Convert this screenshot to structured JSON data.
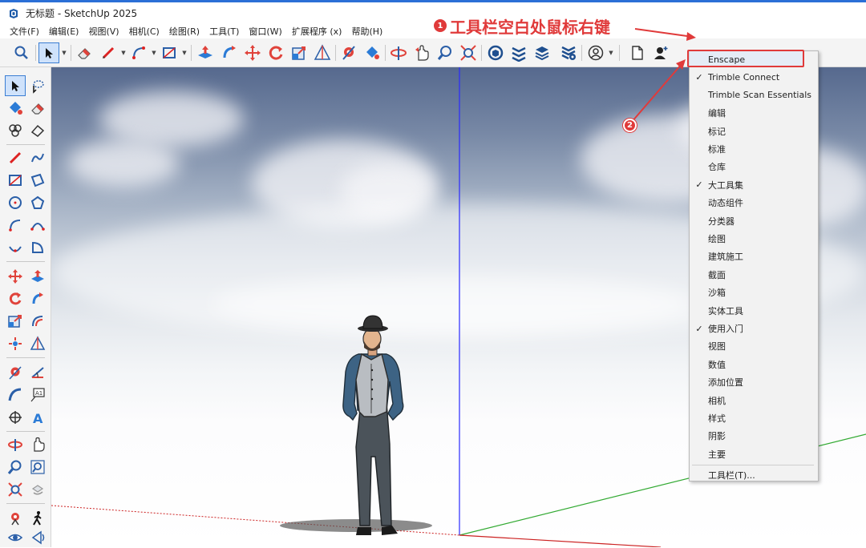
{
  "window": {
    "title": "无标题 - SketchUp 2025",
    "accent": "#2b6fd6"
  },
  "menubar": {
    "items": [
      "文件(F)",
      "编辑(E)",
      "视图(V)",
      "相机(C)",
      "绘图(R)",
      "工具(T)",
      "窗口(W)",
      "扩展程序 (x)",
      "帮助(H)"
    ]
  },
  "toolbar": {
    "icons": [
      "zoom-extents-icon",
      "select-icon",
      "eraser-icon",
      "pencil-line-icon",
      "arc-icon",
      "rectangle-icon",
      "push-pull-icon",
      "follow-me-icon",
      "move-icon",
      "rotate-icon",
      "scale-icon",
      "tape-icon",
      "position-camera-icon",
      "paint-bucket-icon",
      "orbit-icon",
      "pan-icon",
      "zoom-icon",
      "zoom-window-icon",
      "3d-warehouse-icon",
      "extension-warehouse-icon",
      "layout-icon",
      "extension-manager-icon",
      "account-icon",
      "new-file-icon",
      "add-user-icon"
    ]
  },
  "annotation": {
    "step1_badge": "1",
    "step1_text": "工具栏空白处鼠标右键",
    "step2_badge": "2",
    "color": "#e03a3a"
  },
  "context_menu": {
    "items": [
      {
        "label": "Enscape",
        "checked": false,
        "highlighted": true
      },
      {
        "label": "Trimble Connect",
        "checked": true
      },
      {
        "label": "Trimble Scan Essentials",
        "checked": false
      },
      {
        "label": "编辑",
        "checked": false
      },
      {
        "label": "标记",
        "checked": false
      },
      {
        "label": "标准",
        "checked": false
      },
      {
        "label": "仓库",
        "checked": false
      },
      {
        "label": "大工具集",
        "checked": true
      },
      {
        "label": "动态组件",
        "checked": false
      },
      {
        "label": "分类器",
        "checked": false
      },
      {
        "label": "绘图",
        "checked": false
      },
      {
        "label": "建筑施工",
        "checked": false
      },
      {
        "label": "截面",
        "checked": false
      },
      {
        "label": "沙箱",
        "checked": false
      },
      {
        "label": "实体工具",
        "checked": false
      },
      {
        "label": "使用入门",
        "checked": true
      },
      {
        "label": "视图",
        "checked": false
      },
      {
        "label": "数值",
        "checked": false
      },
      {
        "label": "添加位置",
        "checked": false
      },
      {
        "label": "相机",
        "checked": false
      },
      {
        "label": "样式",
        "checked": false
      },
      {
        "label": "阴影",
        "checked": false
      },
      {
        "label": "主要",
        "checked": false
      }
    ],
    "footer": "工具栏(T)...",
    "check_mark": "✓"
  },
  "axes_colors": {
    "blue": "#2a2aff",
    "green": "#33aa33",
    "red": "#cc2222"
  }
}
